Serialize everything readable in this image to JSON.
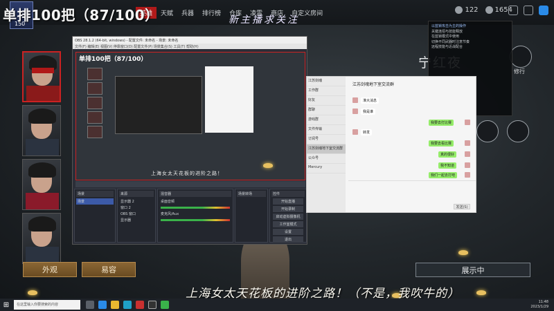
{
  "overlay": {
    "title": "单排100把（87/100）",
    "follow_banner": "新主播求关注",
    "subtitle": "上海女太天花板的进阶之路！（不是，我吹牛的）"
  },
  "game": {
    "nav": [
      "英雄",
      "天赋",
      "兵器",
      "排行榜",
      "仓库",
      "凌霄",
      "商店",
      "自定义房间"
    ],
    "active_nav": "英雄",
    "resources": [
      "122",
      "1654"
    ],
    "character_name": "宁红夜",
    "character_tag": "修行",
    "buttons": {
      "appearance": "外观",
      "easy_face": "易容",
      "display": "展示中"
    }
  },
  "tooltip": {
    "lines": [
      "以蓝锁攻击为主的操作",
      "关键连招与技能释放",
      "在蓝锁模式中使用",
      "切换不同武器时注意节奏",
      "远程技能与近战配合"
    ]
  },
  "obs": {
    "title": "OBS 28.1.2 (64-bit, windows) - 配置文件: 未命名 - 场景: 未命名",
    "menu": "文件(F) 编辑(E) 视图(V) 停靠窗口(D) 配置文件(P) 场景集合(S) 工具(T) 帮助(H)",
    "preview_title": "单排100把（87/100）",
    "preview_sub": "上海女太天花板的进阶之路！",
    "scenes_header": "场景",
    "scenes": [
      "场景"
    ],
    "sources_header": "来源",
    "sources": [
      "显示器 2",
      "窗口 2",
      "OBS 窗口",
      "显示器"
    ],
    "mixer_header": "混音器",
    "mixer": [
      "桌面音频",
      "麦克风/Aux"
    ],
    "transitions_header": "场景转场",
    "controls_header": "控件",
    "controls": [
      "开始直播",
      "开始录制",
      "启动虚拟摄像机",
      "工作室模式",
      "设置",
      "退出"
    ]
  },
  "chat": {
    "header": "江苏剑魂地下室交流群",
    "contacts": [
      "江苏剑魂",
      "工作群",
      "好友",
      "群聊",
      "游戏群",
      "文件传输",
      "订阅号",
      "江苏剑魂地下室交流群",
      "公众号",
      "Mercury"
    ],
    "messages_in": [
      "淮大消息",
      "我是谁",
      "转发"
    ],
    "messages_out": [
      "我要去打比赛",
      "我要去看比赛",
      "真的很好",
      "我不知道",
      "我们一起去打吧"
    ],
    "send": "发送(S)"
  },
  "taskbar": {
    "search_placeholder": "在这里输入你要搜索的内容",
    "time": "11:48",
    "date": "2023/1/29"
  }
}
